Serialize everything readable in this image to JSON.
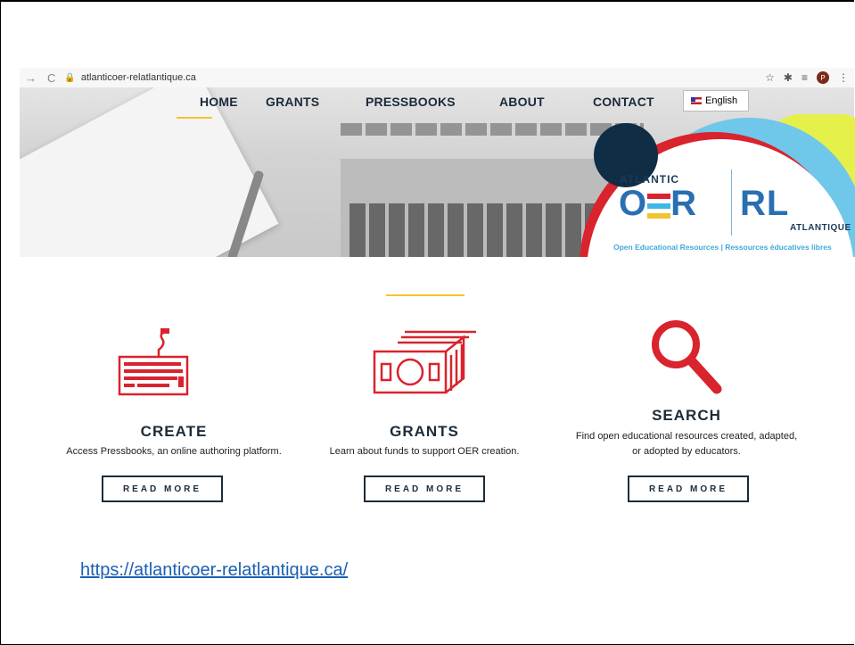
{
  "browser": {
    "url": "atlanticoer-relatlantique.ca",
    "avatar_letter": "P"
  },
  "nav": {
    "items": [
      "HOME",
      "GRANTS",
      "PRESSBOOKS",
      "ABOUT",
      "CONTACT"
    ],
    "language": "English"
  },
  "logo": {
    "top_left": "ATLANTIC",
    "main_left": "OER",
    "main_right": "REL",
    "bottom_right": "ATLANTIQUE",
    "tagline": "Open Educational Resources | Ressources éducatives libres"
  },
  "cards": [
    {
      "title": "CREATE",
      "description": "Access Pressbooks, an online authoring platform.",
      "button": "READ MORE",
      "icon": "keyboard-icon"
    },
    {
      "title": "GRANTS",
      "description": "Learn about funds to support OER creation.",
      "button": "READ MORE",
      "icon": "money-icon"
    },
    {
      "title": "SEARCH",
      "description_line1": "Find open educational resources created, adapted,",
      "description_line2": "or adopted by educators.",
      "button": "READ MORE",
      "icon": "search-icon"
    }
  ],
  "footer_link": "https://atlanticoer-relatlantique.ca/",
  "colors": {
    "accent": "#d9232d",
    "navy": "#1c2b3a",
    "gold": "#f4c430",
    "blue": "#2a6fb2"
  }
}
